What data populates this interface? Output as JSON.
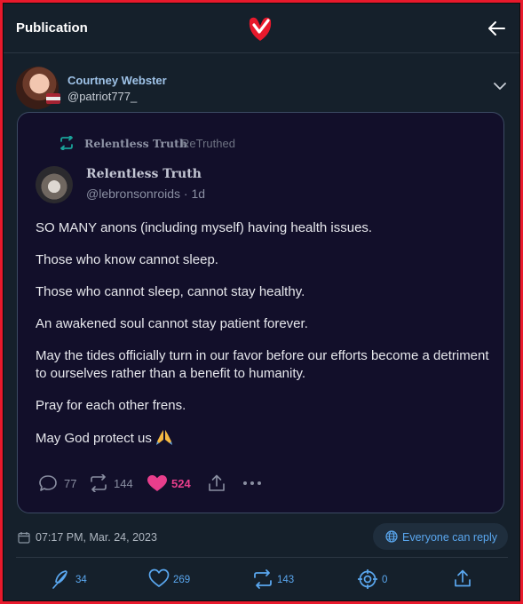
{
  "header": {
    "title": "Publication",
    "logo_icon": "truth-social-logo",
    "back_icon": "arrow-left-icon"
  },
  "post": {
    "author": {
      "name": "Courtney Webster",
      "handle": "@patriot777_"
    },
    "retruth": {
      "name": "Relentless Truth",
      "suffix": "ReTruthed"
    },
    "quoted": {
      "name": "Relentless Truth",
      "handle_time": "@lebronsonroids · 1d",
      "paragraphs": [
        "SO MANY anons (including myself) having health issues.",
        "Those who know cannot sleep.",
        "Those who cannot sleep, cannot stay healthy.",
        "An awakened soul cannot stay patient forever.",
        "May the tides officially turn in our favor before our efforts become a detriment to ourselves rather than a benefit to humanity.",
        "Pray for each other frens.",
        "May God protect us"
      ],
      "actions": {
        "replies": "77",
        "retruths": "144",
        "likes": "524"
      }
    },
    "timestamp": "07:17 PM, Mar. 24, 2023",
    "reply_permission": "Everyone can reply",
    "stats": {
      "replies": "34",
      "likes": "269",
      "retruths": "143",
      "quotes": "0"
    }
  },
  "colors": {
    "accent": "#5aa7ef",
    "like": "#e83e8c",
    "brand": "#e8192c",
    "background": "#15202b"
  }
}
